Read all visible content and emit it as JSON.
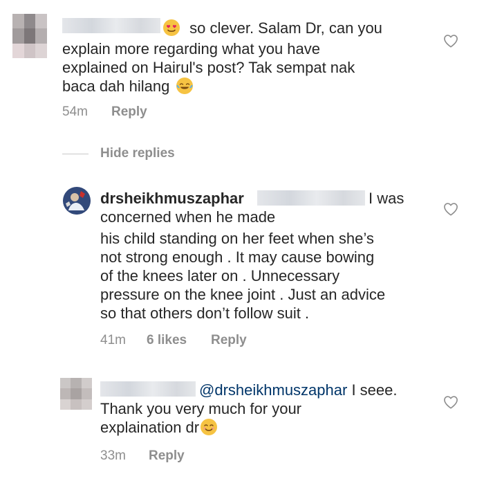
{
  "comment1": {
    "text_line1": "so clever. Salam Dr, can you",
    "text_line2": "explain more regarding what you have",
    "text_line3": "explained on Hairul's post? Tak sempat nak",
    "text_line4": "baca dah hilang",
    "emoji1": "heart-eyes-emoji",
    "emoji2": "tears-of-joy-emoji",
    "time": "54m",
    "reply_label": "Reply"
  },
  "thread": {
    "hide_replies_label": "Hide replies"
  },
  "reply1": {
    "username": "drsheikhmuszaphar",
    "text_line1_tail": "I was",
    "text_line2": "concerned when he made",
    "text_line3": "his child standing on her feet when she’s",
    "text_line4": "not strong enough . It may cause bowing",
    "text_line5": "of the knees later on . Unnecessary",
    "text_line6": "pressure on the knee joint . Just an advice",
    "text_line7": "so that others don’t follow suit .",
    "time": "41m",
    "likes": "6 likes",
    "reply_label": "Reply"
  },
  "reply2": {
    "mention": "@drsheikhmuszaphar",
    "text_line1_tail": "I seee.",
    "text_line2": "Thank you very much for your",
    "text_line3": "explaination dr",
    "emoji": "smiling-emoji",
    "time": "33m",
    "reply_label": "Reply"
  },
  "colors": {
    "text": "#262626",
    "meta": "#8e8e8e",
    "mention": "#003569"
  }
}
